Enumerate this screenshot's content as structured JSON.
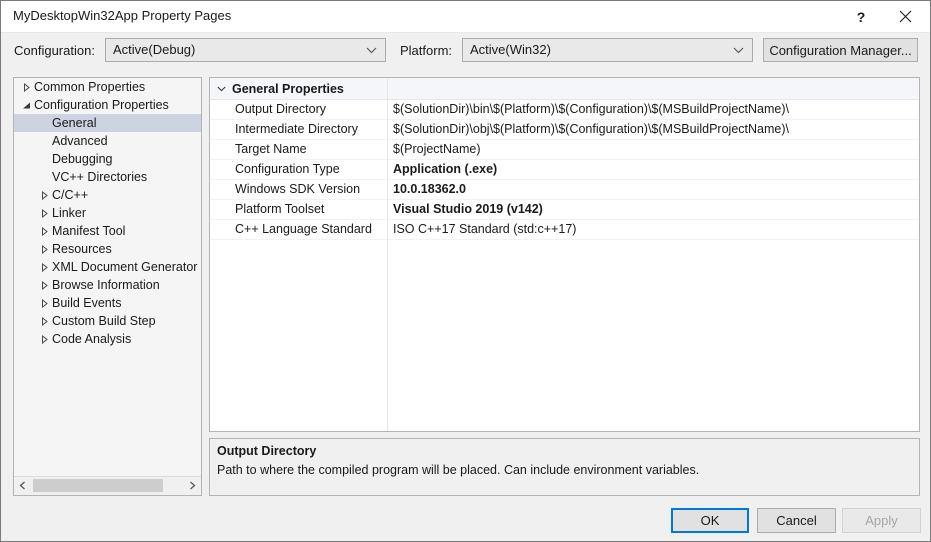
{
  "window": {
    "title": "MyDesktopWin32App Property Pages",
    "help_icon": "question-mark-icon",
    "close_icon": "close-icon"
  },
  "config_bar": {
    "configuration_label": "Configuration:",
    "configuration_value": "Active(Debug)",
    "platform_label": "Platform:",
    "platform_value": "Active(Win32)",
    "configuration_manager_label": "Configuration Manager...",
    "dropdown_icon": "chevron-down-icon"
  },
  "tree": {
    "nodes": [
      {
        "label": "Common Properties",
        "depth": 0,
        "state": "collapsed",
        "selected": false
      },
      {
        "label": "Configuration Properties",
        "depth": 0,
        "state": "expanded",
        "selected": false
      },
      {
        "label": "General",
        "depth": 1,
        "state": "leaf",
        "selected": true
      },
      {
        "label": "Advanced",
        "depth": 1,
        "state": "leaf",
        "selected": false
      },
      {
        "label": "Debugging",
        "depth": 1,
        "state": "leaf",
        "selected": false
      },
      {
        "label": "VC++ Directories",
        "depth": 1,
        "state": "leaf",
        "selected": false
      },
      {
        "label": "C/C++",
        "depth": 1,
        "state": "collapsed",
        "selected": false
      },
      {
        "label": "Linker",
        "depth": 1,
        "state": "collapsed",
        "selected": false
      },
      {
        "label": "Manifest Tool",
        "depth": 1,
        "state": "collapsed",
        "selected": false
      },
      {
        "label": "Resources",
        "depth": 1,
        "state": "collapsed",
        "selected": false
      },
      {
        "label": "XML Document Generator",
        "depth": 1,
        "state": "collapsed",
        "selected": false
      },
      {
        "label": "Browse Information",
        "depth": 1,
        "state": "collapsed",
        "selected": false
      },
      {
        "label": "Build Events",
        "depth": 1,
        "state": "collapsed",
        "selected": false
      },
      {
        "label": "Custom Build Step",
        "depth": 1,
        "state": "collapsed",
        "selected": false
      },
      {
        "label": "Code Analysis",
        "depth": 1,
        "state": "collapsed",
        "selected": false
      }
    ],
    "hscrollbar": {
      "left_arrow_icon": "chevron-left-icon",
      "right_arrow_icon": "chevron-right-icon"
    }
  },
  "grid": {
    "category_label": "General Properties",
    "category_state": "expanded",
    "category_icon": "chevron-down-icon",
    "rows": [
      {
        "name": "Output Directory",
        "value": "$(SolutionDir)\\bin\\$(Platform)\\$(Configuration)\\$(MSBuildProjectName)\\",
        "bold": false
      },
      {
        "name": "Intermediate Directory",
        "value": "$(SolutionDir)\\obj\\$(Platform)\\$(Configuration)\\$(MSBuildProjectName)\\",
        "bold": false
      },
      {
        "name": "Target Name",
        "value": "$(ProjectName)",
        "bold": false
      },
      {
        "name": "Configuration Type",
        "value": "Application (.exe)",
        "bold": true
      },
      {
        "name": "Windows SDK Version",
        "value": "10.0.18362.0",
        "bold": true
      },
      {
        "name": "Platform Toolset",
        "value": "Visual Studio 2019 (v142)",
        "bold": true
      },
      {
        "name": "C++ Language Standard",
        "value": "ISO C++17 Standard (std:c++17)",
        "bold": false
      }
    ]
  },
  "description": {
    "title": "Output Directory",
    "body": "Path to where the compiled program will be placed. Can include environment variables."
  },
  "footer": {
    "ok_label": "OK",
    "cancel_label": "Cancel",
    "apply_label": "Apply",
    "apply_enabled": false
  },
  "colors": {
    "accent": "#0078d7",
    "selection": "#cdd3e1",
    "dialog_background": "#f0f0f0",
    "grid_header": "#f4f6fa"
  }
}
